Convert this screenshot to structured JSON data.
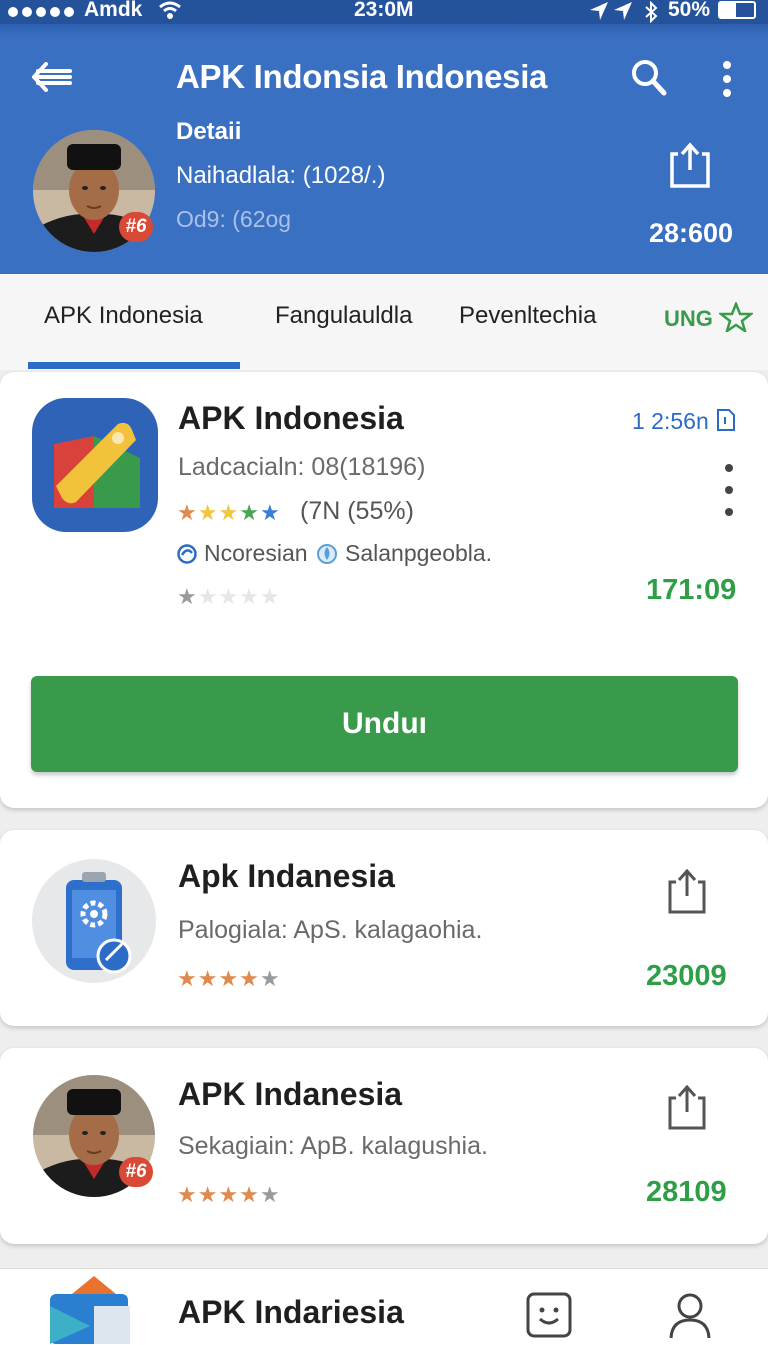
{
  "status_bar": {
    "carrier": "Amdk",
    "time": "23:0M",
    "battery": "50%"
  },
  "header": {
    "title": "APK Indonsia Indonesia",
    "detail_label": "Detaii",
    "name_line": "Naihadlala: (1028/.)",
    "sub_line": "Od9: (62og",
    "count": "28:600",
    "avatar_badge": "#6"
  },
  "tabs": [
    {
      "label": "APK Indonesia",
      "active": true
    },
    {
      "label": "Fangulauldla",
      "active": false
    },
    {
      "label": "Pevenltechia",
      "active": false
    },
    {
      "label": "UNG",
      "active": false
    }
  ],
  "featured": {
    "title": "APK Indonesia",
    "time_label": "1 2:56n",
    "subtitle": "Ladcacialn: 08(18196)",
    "rating_text": "(7N (55%)",
    "tag1": "Ncoresian",
    "tag2": "Salanpgeobla.",
    "number": "171:09",
    "download_label": "Unduı",
    "rating_stars": 5,
    "secondary_stars": 1
  },
  "list": [
    {
      "title": "Apk Indanesia",
      "subtitle": "Palogiala: ApS. kalagaohia.",
      "number": "23009",
      "stars": 4,
      "icon": "settings-phone-icon"
    },
    {
      "title": "APK Indanesia",
      "subtitle": "Sekagiain: ApB. kalagushia.",
      "number": "28109",
      "stars": 4,
      "icon": "avatar",
      "badge": "#6"
    }
  ],
  "bottom": {
    "title": "APK Indariesia"
  },
  "colors": {
    "header_blue": "#3a70c2",
    "download_green": "#3a9a4b",
    "number_green": "#2e9e47",
    "tab_indicator": "#2d6cc6",
    "star_orange": "#e08a4e"
  }
}
